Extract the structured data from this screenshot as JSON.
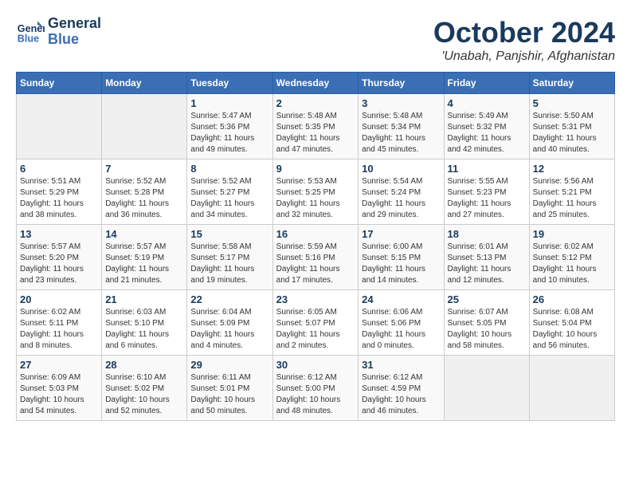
{
  "header": {
    "logo_line1": "General",
    "logo_line2": "Blue",
    "month_title": "October 2024",
    "location": "'Unabah, Panjshir, Afghanistan"
  },
  "weekdays": [
    "Sunday",
    "Monday",
    "Tuesday",
    "Wednesday",
    "Thursday",
    "Friday",
    "Saturday"
  ],
  "weeks": [
    [
      {
        "day": "",
        "info": ""
      },
      {
        "day": "",
        "info": ""
      },
      {
        "day": "1",
        "info": "Sunrise: 5:47 AM\nSunset: 5:36 PM\nDaylight: 11 hours and 49 minutes."
      },
      {
        "day": "2",
        "info": "Sunrise: 5:48 AM\nSunset: 5:35 PM\nDaylight: 11 hours and 47 minutes."
      },
      {
        "day": "3",
        "info": "Sunrise: 5:48 AM\nSunset: 5:34 PM\nDaylight: 11 hours and 45 minutes."
      },
      {
        "day": "4",
        "info": "Sunrise: 5:49 AM\nSunset: 5:32 PM\nDaylight: 11 hours and 42 minutes."
      },
      {
        "day": "5",
        "info": "Sunrise: 5:50 AM\nSunset: 5:31 PM\nDaylight: 11 hours and 40 minutes."
      }
    ],
    [
      {
        "day": "6",
        "info": "Sunrise: 5:51 AM\nSunset: 5:29 PM\nDaylight: 11 hours and 38 minutes."
      },
      {
        "day": "7",
        "info": "Sunrise: 5:52 AM\nSunset: 5:28 PM\nDaylight: 11 hours and 36 minutes."
      },
      {
        "day": "8",
        "info": "Sunrise: 5:52 AM\nSunset: 5:27 PM\nDaylight: 11 hours and 34 minutes."
      },
      {
        "day": "9",
        "info": "Sunrise: 5:53 AM\nSunset: 5:25 PM\nDaylight: 11 hours and 32 minutes."
      },
      {
        "day": "10",
        "info": "Sunrise: 5:54 AM\nSunset: 5:24 PM\nDaylight: 11 hours and 29 minutes."
      },
      {
        "day": "11",
        "info": "Sunrise: 5:55 AM\nSunset: 5:23 PM\nDaylight: 11 hours and 27 minutes."
      },
      {
        "day": "12",
        "info": "Sunrise: 5:56 AM\nSunset: 5:21 PM\nDaylight: 11 hours and 25 minutes."
      }
    ],
    [
      {
        "day": "13",
        "info": "Sunrise: 5:57 AM\nSunset: 5:20 PM\nDaylight: 11 hours and 23 minutes."
      },
      {
        "day": "14",
        "info": "Sunrise: 5:57 AM\nSunset: 5:19 PM\nDaylight: 11 hours and 21 minutes."
      },
      {
        "day": "15",
        "info": "Sunrise: 5:58 AM\nSunset: 5:17 PM\nDaylight: 11 hours and 19 minutes."
      },
      {
        "day": "16",
        "info": "Sunrise: 5:59 AM\nSunset: 5:16 PM\nDaylight: 11 hours and 17 minutes."
      },
      {
        "day": "17",
        "info": "Sunrise: 6:00 AM\nSunset: 5:15 PM\nDaylight: 11 hours and 14 minutes."
      },
      {
        "day": "18",
        "info": "Sunrise: 6:01 AM\nSunset: 5:13 PM\nDaylight: 11 hours and 12 minutes."
      },
      {
        "day": "19",
        "info": "Sunrise: 6:02 AM\nSunset: 5:12 PM\nDaylight: 11 hours and 10 minutes."
      }
    ],
    [
      {
        "day": "20",
        "info": "Sunrise: 6:02 AM\nSunset: 5:11 PM\nDaylight: 11 hours and 8 minutes."
      },
      {
        "day": "21",
        "info": "Sunrise: 6:03 AM\nSunset: 5:10 PM\nDaylight: 11 hours and 6 minutes."
      },
      {
        "day": "22",
        "info": "Sunrise: 6:04 AM\nSunset: 5:09 PM\nDaylight: 11 hours and 4 minutes."
      },
      {
        "day": "23",
        "info": "Sunrise: 6:05 AM\nSunset: 5:07 PM\nDaylight: 11 hours and 2 minutes."
      },
      {
        "day": "24",
        "info": "Sunrise: 6:06 AM\nSunset: 5:06 PM\nDaylight: 11 hours and 0 minutes."
      },
      {
        "day": "25",
        "info": "Sunrise: 6:07 AM\nSunset: 5:05 PM\nDaylight: 10 hours and 58 minutes."
      },
      {
        "day": "26",
        "info": "Sunrise: 6:08 AM\nSunset: 5:04 PM\nDaylight: 10 hours and 56 minutes."
      }
    ],
    [
      {
        "day": "27",
        "info": "Sunrise: 6:09 AM\nSunset: 5:03 PM\nDaylight: 10 hours and 54 minutes."
      },
      {
        "day": "28",
        "info": "Sunrise: 6:10 AM\nSunset: 5:02 PM\nDaylight: 10 hours and 52 minutes."
      },
      {
        "day": "29",
        "info": "Sunrise: 6:11 AM\nSunset: 5:01 PM\nDaylight: 10 hours and 50 minutes."
      },
      {
        "day": "30",
        "info": "Sunrise: 6:12 AM\nSunset: 5:00 PM\nDaylight: 10 hours and 48 minutes."
      },
      {
        "day": "31",
        "info": "Sunrise: 6:12 AM\nSunset: 4:59 PM\nDaylight: 10 hours and 46 minutes."
      },
      {
        "day": "",
        "info": ""
      },
      {
        "day": "",
        "info": ""
      }
    ]
  ]
}
